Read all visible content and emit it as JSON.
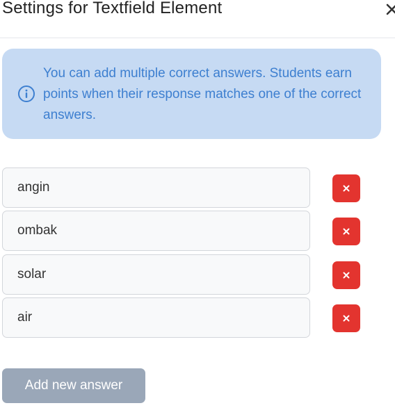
{
  "dialog": {
    "title": "Settings for Textfield Element",
    "close_icon": "close-icon"
  },
  "info": {
    "icon": "info-circle-icon",
    "text": "You can add multiple correct answers. Students earn points when their response matches one of the correct answers.",
    "background_color": "#c6daf3",
    "text_color": "#3d7fd0"
  },
  "answers": [
    {
      "value": "angin"
    },
    {
      "value": "ombak"
    },
    {
      "value": "solar"
    },
    {
      "value": "air"
    }
  ],
  "delete_button": {
    "icon": "close-icon",
    "color": "#e3342f"
  },
  "add_button": {
    "label": "Add new answer",
    "color": "#9aa7b8"
  }
}
